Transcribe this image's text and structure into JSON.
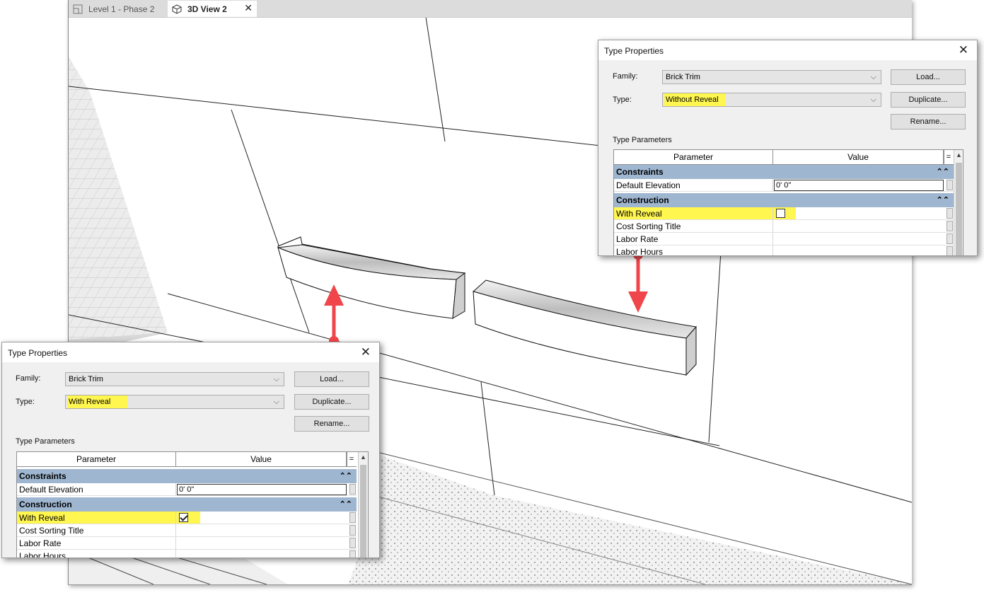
{
  "tabs": [
    {
      "label": "Level 1 - Phase 2",
      "icon": "floor-plan-icon"
    },
    {
      "label": "3D View 2",
      "icon": "3d-cube-icon",
      "close": "✕"
    }
  ],
  "dialog_right": {
    "title": "Type Properties",
    "close": "✕",
    "family_label": "Family:",
    "family_value": "Brick Trim",
    "type_label": "Type:",
    "type_value": "Without Reveal",
    "load_btn": "Load...",
    "duplicate_btn": "Duplicate...",
    "rename_btn": "Rename...",
    "type_parameters_label": "Type Parameters",
    "col_parameter": "Parameter",
    "col_value": "Value",
    "eq": "=",
    "cat_constraints": "Constraints",
    "cat_construction": "Construction",
    "default_elevation": "Default Elevation",
    "default_elevation_value": "0'  0\"",
    "with_reveal": "With Reveal",
    "with_reveal_checked": false,
    "cost_sorting_title": "Cost Sorting Title",
    "labor_rate": "Labor Rate",
    "labor_hours": "Labor Hours"
  },
  "dialog_left": {
    "title": "Type Properties",
    "close": "✕",
    "family_label": "Family:",
    "family_value": "Brick Trim",
    "type_label": "Type:",
    "type_value": "With Reveal",
    "load_btn": "Load...",
    "duplicate_btn": "Duplicate...",
    "rename_btn": "Rename...",
    "type_parameters_label": "Type Parameters",
    "col_parameter": "Parameter",
    "col_value": "Value",
    "eq": "=",
    "cat_constraints": "Constraints",
    "cat_construction": "Construction",
    "default_elevation": "Default Elevation",
    "default_elevation_value": "0'  0\"",
    "with_reveal": "With Reveal",
    "with_reveal_checked": true,
    "cost_sorting_title": "Cost Sorting Title",
    "labor_rate": "Labor Rate",
    "labor_hours": "Labor Hours"
  },
  "colors": {
    "highlight": "#fff650",
    "category_bar": "#9fb6d0",
    "arrow": "#f0454a"
  }
}
